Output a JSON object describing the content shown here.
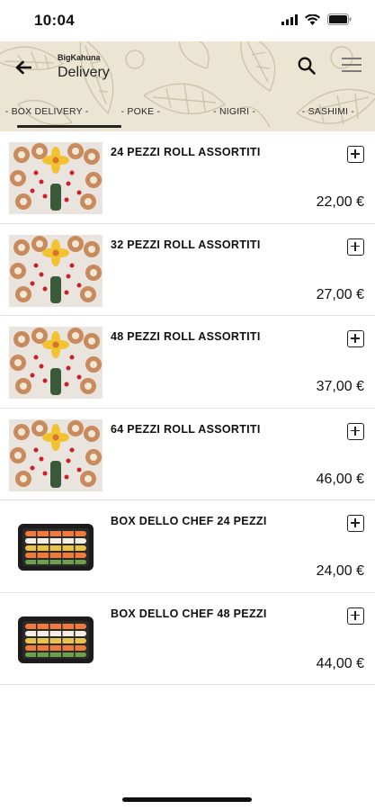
{
  "status_bar": {
    "time": "10:04",
    "icons": [
      "signal-icon",
      "wifi-icon",
      "battery-icon"
    ]
  },
  "header": {
    "brand": "BigKahuna",
    "title": "Delivery",
    "icons": {
      "back": "back-arrow-icon",
      "search": "search-icon",
      "menu": "hamburger-menu-icon"
    }
  },
  "tabs": [
    {
      "label": "- BOX DELIVERY -",
      "active": true
    },
    {
      "label": "- POKE -",
      "active": false
    },
    {
      "label": "- NIGIRI -",
      "active": false
    },
    {
      "label": "- SASHIMI -",
      "active": false
    }
  ],
  "products": [
    {
      "name": "24 PEZZI ROLL ASSORTITI",
      "price": "22,00 €",
      "image": "sushi-platter-roll"
    },
    {
      "name": "32 PEZZI ROLL ASSORTITI",
      "price": "27,00 €",
      "image": "sushi-platter-roll"
    },
    {
      "name": "48 PEZZI ROLL ASSORTITI",
      "price": "37,00 €",
      "image": "sushi-platter-roll"
    },
    {
      "name": "64 PEZZI ROLL ASSORTITI",
      "price": "46,00 €",
      "image": "sushi-platter-roll"
    },
    {
      "name": "BOX DELLO CHEF 24 PEZZI",
      "price": "24,00 €",
      "image": "sushi-box-tray"
    },
    {
      "name": "BOX DELLO CHEF 48 PEZZI",
      "price": "44,00 €",
      "image": "sushi-box-tray"
    }
  ],
  "colors": {
    "header_bg": "#ebe5d4",
    "text": "#111111",
    "divider": "#e2e2e2"
  }
}
